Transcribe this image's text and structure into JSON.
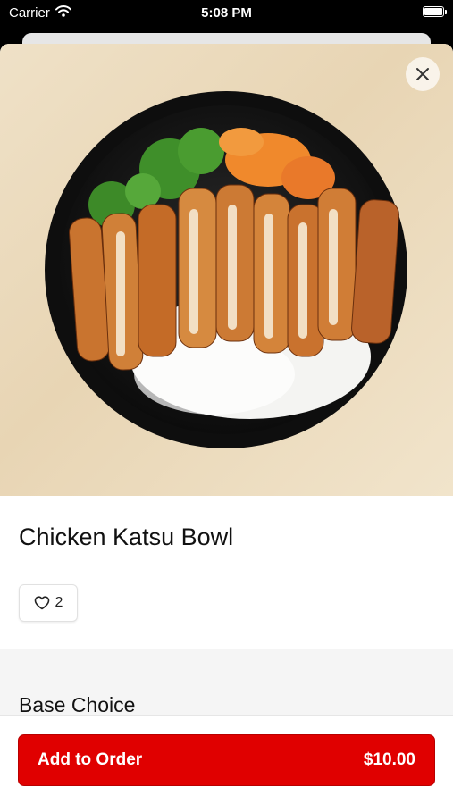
{
  "status_bar": {
    "carrier": "Carrier",
    "time": "5:08 PM"
  },
  "item": {
    "name": "Chicken Katsu Bowl",
    "likes": "2",
    "image_alt": "chicken-katsu-bowl-photo"
  },
  "options": {
    "section_title": "Base Choice"
  },
  "footer": {
    "add_label": "Add to Order",
    "price": "$10.00"
  },
  "colors": {
    "accent": "#e00000",
    "sheet_bg": "#ffffff",
    "section_bg": "#f5f5f5"
  }
}
